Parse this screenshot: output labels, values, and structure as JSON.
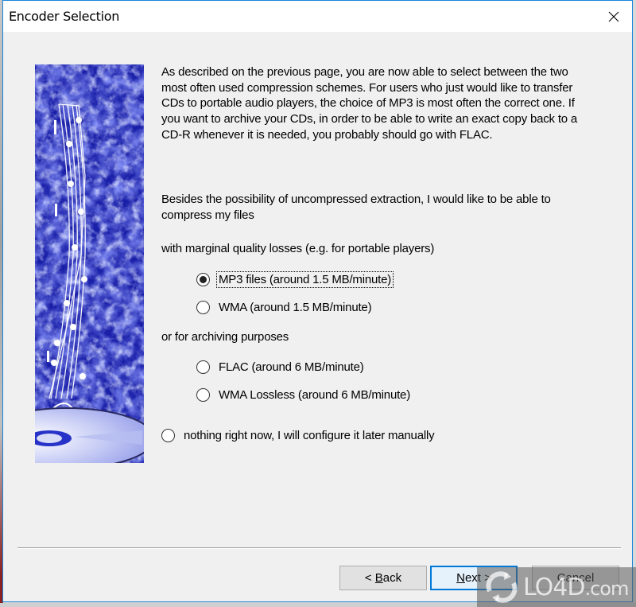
{
  "window": {
    "title": "Encoder Selection",
    "close_icon": "close-icon"
  },
  "side_image": {
    "description": "blue textured banner with music staff, notes, treble clef and CD disc"
  },
  "content": {
    "intro_paragraph": "As described on the previous page, you are now able to select between the two most often used compression schemes. For users who just would like to transfer CDs to portable audio players, the choice of MP3 is most often the correct one. If you want to archive your CDs, in order to be able to write an exact copy back to a CD-R whenever it is needed, you probably should go with FLAC.",
    "question_paragraph": "Besides the possibility of uncompressed extraction, I would like to be able to compress my files",
    "lossy_group_label": "with marginal quality losses (e.g. for portable players)",
    "archive_group_label": "or for archiving purposes",
    "options": [
      {
        "id": "mp3",
        "label": "MP3 files (around 1.5 MB/minute)",
        "checked": true,
        "focused": true
      },
      {
        "id": "wma",
        "label": "WMA (around 1.5 MB/minute)",
        "checked": false
      },
      {
        "id": "flac",
        "label": "FLAC (around 6 MB/minute)",
        "checked": false
      },
      {
        "id": "wma-lossless",
        "label": "WMA Lossless (around 6 MB/minute)",
        "checked": false
      },
      {
        "id": "nothing",
        "label": "nothing right now, I will configure it later manually",
        "checked": false
      }
    ]
  },
  "buttons": {
    "back_prefix": "< ",
    "back_accel": "B",
    "back_rest": "ack",
    "next_accel": "N",
    "next_rest": "ext >",
    "cancel_label": "Cancel"
  },
  "watermark": {
    "brand": "LO4D",
    "suffix": ".com"
  },
  "colors": {
    "window_border": "#1883d7",
    "default_button_border": "#0078d7",
    "dialog_bg": "#f0f0f0"
  }
}
